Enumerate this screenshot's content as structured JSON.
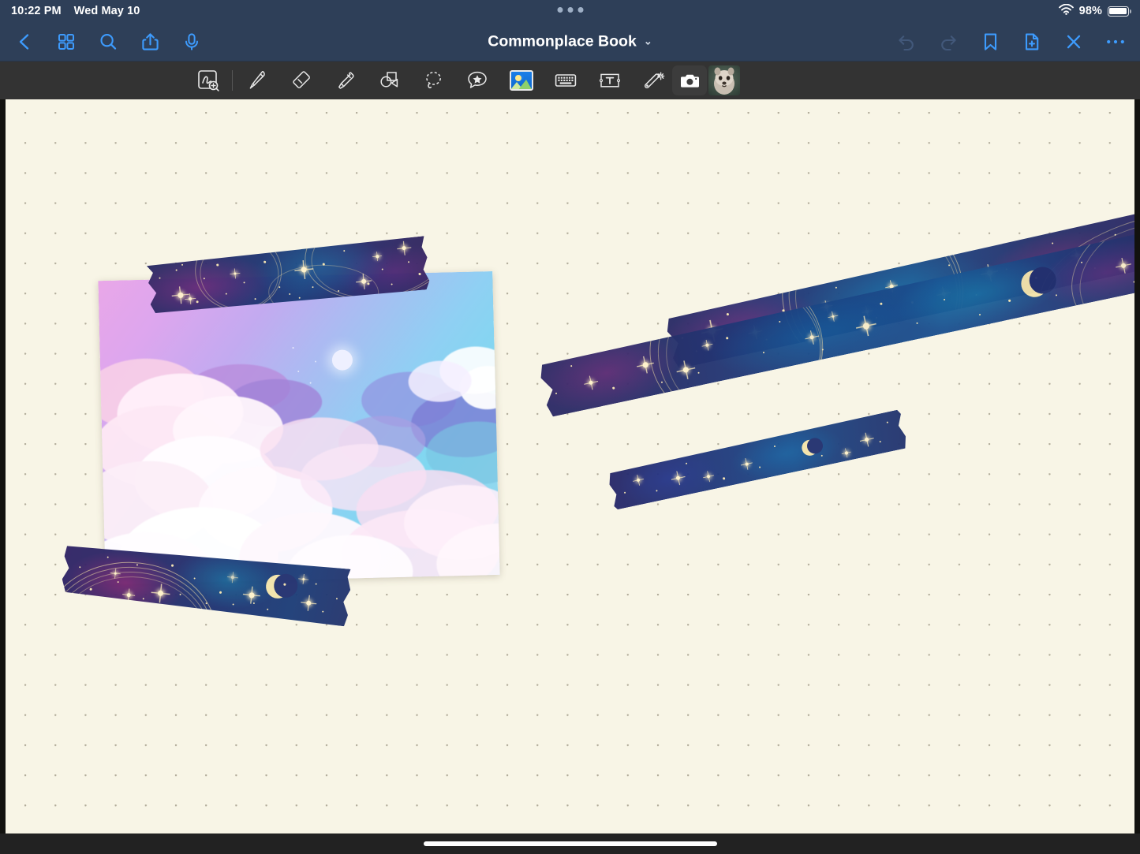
{
  "status_bar": {
    "time": "10:22 PM",
    "date": "Wed May 10",
    "battery_percent": "98%",
    "wifi_icon": "wifi-icon",
    "battery_icon": "battery-icon",
    "multitask_handle": "multitask-dots"
  },
  "nav_bar": {
    "title": "Commonplace Book",
    "title_chevron": "⌄",
    "left_items": [
      {
        "name": "back-button",
        "icon": "chevron-left-icon"
      },
      {
        "name": "page-grid-button",
        "icon": "grid-icon"
      },
      {
        "name": "search-button",
        "icon": "search-icon"
      },
      {
        "name": "share-button",
        "icon": "share-icon"
      },
      {
        "name": "record-audio-button",
        "icon": "microphone-icon"
      }
    ],
    "right_items": [
      {
        "name": "undo-button",
        "icon": "undo-icon",
        "enabled": false
      },
      {
        "name": "redo-button",
        "icon": "redo-icon",
        "enabled": false
      },
      {
        "name": "bookmark-button",
        "icon": "bookmark-icon",
        "enabled": true
      },
      {
        "name": "add-page-button",
        "icon": "new-page-icon",
        "enabled": true
      },
      {
        "name": "close-button",
        "icon": "close-x-icon",
        "enabled": true
      },
      {
        "name": "more-options-button",
        "icon": "ellipsis-icon",
        "enabled": true
      }
    ]
  },
  "toolbar": {
    "tools": [
      {
        "name": "zoom-write-tool",
        "icon": "zoom-write-icon",
        "active": false
      },
      {
        "name": "pen-tool",
        "icon": "pen-icon",
        "active": false
      },
      {
        "name": "eraser-tool",
        "icon": "eraser-icon",
        "active": false
      },
      {
        "name": "highlighter-tool",
        "icon": "highlighter-icon",
        "active": false
      },
      {
        "name": "shapes-tool",
        "icon": "shapes-icon",
        "active": false
      },
      {
        "name": "lasso-tool",
        "icon": "lasso-icon",
        "active": false
      },
      {
        "name": "sticker-tool",
        "icon": "sticker-star-icon",
        "active": false
      },
      {
        "name": "photo-tool",
        "icon": "photo-image-icon",
        "active": true
      },
      {
        "name": "keyboard-tool",
        "icon": "keyboard-icon",
        "active": false
      },
      {
        "name": "text-box-tool",
        "icon": "text-box-icon",
        "active": false
      },
      {
        "name": "magic-wand-tool",
        "icon": "magic-wand-icon",
        "active": false
      }
    ],
    "camera_button": {
      "name": "camera-button",
      "icon": "camera-icon"
    },
    "recent_photo": {
      "name": "recent-photo-thumbnail",
      "subject": "seal-photo"
    }
  },
  "canvas": {
    "paper_color": "#f8f5e6",
    "dot_grid": true,
    "dot_spacing_px": 38,
    "elements": [
      {
        "name": "sky-clouds-photo",
        "type": "image",
        "subject": "pastel clouds sky with moon",
        "rotation_deg": -1.5
      },
      {
        "name": "washi-tape-top",
        "type": "washi-tape",
        "rotation_deg": -6
      },
      {
        "name": "washi-tape-bottom-left",
        "type": "washi-tape",
        "rotation_deg": 6
      },
      {
        "name": "washi-tape-right-upper",
        "type": "washi-tape",
        "rotation_deg": -12
      },
      {
        "name": "washi-tape-right-middle",
        "type": "washi-tape",
        "rotation_deg": -12
      },
      {
        "name": "washi-tape-right-lower",
        "type": "washi-tape",
        "rotation_deg": -12
      }
    ]
  },
  "home_indicator": {
    "name": "home-indicator"
  },
  "colors": {
    "status_bar_bg": "#2e3f58",
    "nav_bar_bg": "#2e3f58",
    "toolbar_bg": "#333333",
    "accent_blue": "#3d9bfd",
    "paper": "#f8f5e6",
    "washi_navy": "#23306e",
    "washi_gold": "#f3e3ab"
  }
}
